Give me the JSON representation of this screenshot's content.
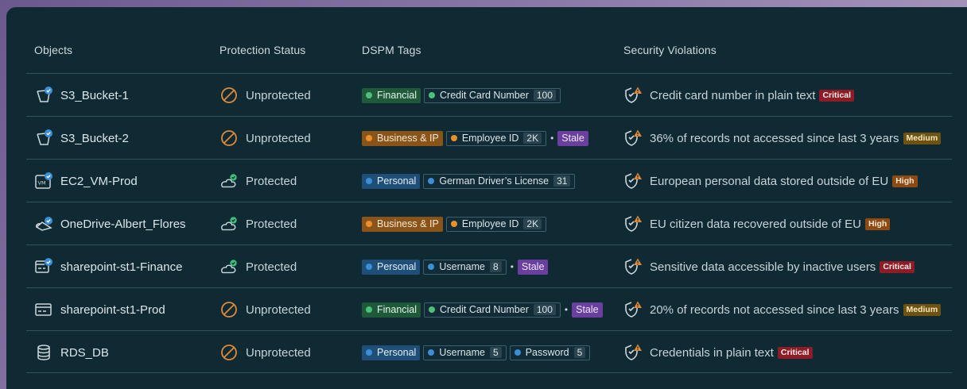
{
  "columns": {
    "objects": "Objects",
    "protection": "Protection Status",
    "tags": "DSPM Tags",
    "violations": "Security Violations"
  },
  "rows": [
    {
      "object": "S3_Bucket-1",
      "object_icon": "bucket-icon",
      "status": "Unprotected",
      "tags": [
        {
          "type": "category",
          "style": "fin",
          "label": "Financial"
        },
        {
          "type": "data",
          "dot": "g",
          "label": "Credit Card Number",
          "count": "100"
        }
      ],
      "violation": "Credit card number in plain text",
      "severity": "Critical"
    },
    {
      "object": "S3_Bucket-2",
      "object_icon": "bucket-icon",
      "status": "Unprotected",
      "tags": [
        {
          "type": "category",
          "style": "biz",
          "label": "Business & IP"
        },
        {
          "type": "data",
          "dot": "o",
          "label": "Employee ID",
          "count": "2K"
        },
        {
          "type": "stale",
          "label": "Stale"
        }
      ],
      "violation": "36% of records not accessed since last 3 years",
      "severity": "Medium"
    },
    {
      "object": "EC2_VM-Prod",
      "object_icon": "vm-icon",
      "status": "Protected",
      "tags": [
        {
          "type": "category",
          "style": "per",
          "label": "Personal"
        },
        {
          "type": "data",
          "dot": "b",
          "label": "German Driver’s License",
          "count": "31"
        }
      ],
      "violation": "European personal data stored outside of EU",
      "severity": "High"
    },
    {
      "object": "OneDrive-Albert_Flores",
      "object_icon": "cloud-drive-icon",
      "status": "Protected",
      "tags": [
        {
          "type": "category",
          "style": "biz",
          "label": "Business & IP"
        },
        {
          "type": "data",
          "dot": "o",
          "label": "Employee ID",
          "count": "2K"
        }
      ],
      "violation": "EU citizen data recovered outside of EU",
      "severity": "High"
    },
    {
      "object": "sharepoint-st1-Finance",
      "object_icon": "site-icon",
      "status": "Protected",
      "tags": [
        {
          "type": "category",
          "style": "per",
          "label": "Personal"
        },
        {
          "type": "data",
          "dot": "b",
          "label": "Username",
          "count": "8"
        },
        {
          "type": "stale",
          "label": "Stale"
        }
      ],
      "violation": "Sensitive data accessible by inactive users",
      "severity": "Critical"
    },
    {
      "object": "sharepoint-st1-Prod",
      "object_icon": "site-icon",
      "status": "Unprotected",
      "tags": [
        {
          "type": "category",
          "style": "fin",
          "label": "Financial"
        },
        {
          "type": "data",
          "dot": "g",
          "label": "Credit Card Number",
          "count": "100"
        },
        {
          "type": "stale",
          "label": "Stale"
        }
      ],
      "violation": "20% of records not accessed since last 3 years",
      "severity": "Medium"
    },
    {
      "object": "RDS_DB",
      "object_icon": "database-icon",
      "status": "Unprotected",
      "tags": [
        {
          "type": "category",
          "style": "per",
          "label": "Personal"
        },
        {
          "type": "data",
          "dot": "b",
          "label": "Username",
          "count": "5"
        },
        {
          "type": "data",
          "dot": "b",
          "label": "Password",
          "count": "5"
        }
      ],
      "violation": "Credentials in plain text",
      "severity": "Critical"
    }
  ],
  "colors": {
    "panel_bg": "#0f2a33",
    "critical": "#8e1c26",
    "medium": "#6e5212",
    "high": "#8e4a12",
    "protected_icon": "#3ec07a",
    "unprotected_icon": "#e08a3a"
  }
}
